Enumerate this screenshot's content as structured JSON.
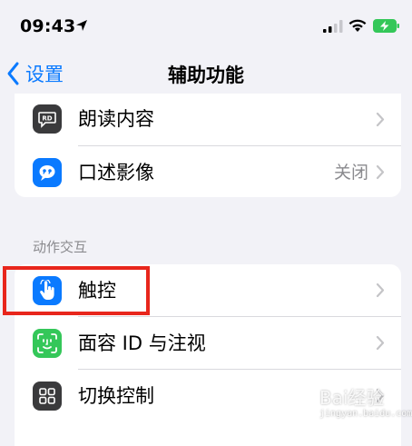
{
  "status_bar": {
    "time": "09:43",
    "icons": [
      "location-arrow-icon",
      "cellular-signal-icon",
      "wifi-icon",
      "battery-charging-icon"
    ],
    "battery_color": "#34c759"
  },
  "nav": {
    "back_label": "设置",
    "title": "辅助功能",
    "accent_color": "#0a7aff"
  },
  "group_vision": {
    "items": [
      {
        "label": "朗读内容",
        "value": "",
        "icon": "speech-bubble-icon",
        "icon_color": "#3a3a3c"
      },
      {
        "label": "口述影像",
        "value": "关闭",
        "icon": "quote-bubble-icon",
        "icon_color": "#0a7aff"
      }
    ]
  },
  "section_interaction": {
    "header": "动作交互",
    "items": [
      {
        "label": "触控",
        "value": "",
        "icon": "hand-pointer-icon",
        "icon_color": "#0a7aff"
      },
      {
        "label": "面容 ID 与注视",
        "value": "",
        "icon": "face-id-icon",
        "icon_color": "#34c759"
      },
      {
        "label": "切换控制",
        "value": "",
        "icon": "grid-icon",
        "icon_color": "#3a3a3c"
      }
    ]
  },
  "annotation": {
    "highlight_color": "#e8261c"
  },
  "watermark": {
    "text": "Bai经验",
    "url": "jingyan.baidu.com"
  }
}
